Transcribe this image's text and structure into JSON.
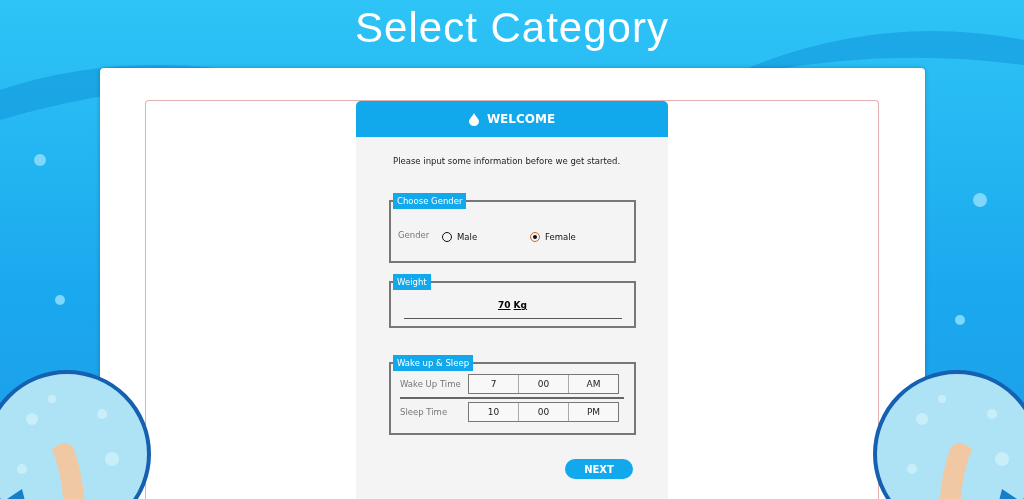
{
  "title": "Select Category",
  "dialog": {
    "title": "WELCOME",
    "intro": "Please input some information before we get started.",
    "gender": {
      "legend": "Choose Gender",
      "label": "Gender",
      "options": [
        {
          "label": "Male",
          "selected": false
        },
        {
          "label": "Female",
          "selected": true
        }
      ]
    },
    "weight": {
      "legend": "Weight",
      "value": "70",
      "unit": "Kg"
    },
    "schedule": {
      "legend": "Wake up & Sleep",
      "rows": [
        {
          "label": "Wake Up Time",
          "hour": "7",
          "minute": "00",
          "period": "AM"
        },
        {
          "label": "Sleep Time",
          "hour": "10",
          "minute": "00",
          "period": "PM"
        }
      ]
    },
    "next_button": "NEXT"
  }
}
